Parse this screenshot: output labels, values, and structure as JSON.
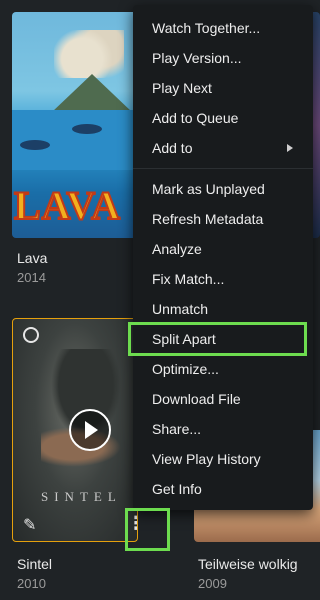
{
  "library": {
    "items": [
      {
        "title": "Lava",
        "year": "2014",
        "poster_text": "LAVA"
      },
      {
        "title": "Sintel",
        "year": "2010",
        "poster_text": "SINTEL"
      },
      {
        "title": "Teilweise wolkig",
        "year": "2009"
      }
    ]
  },
  "context_menu": {
    "items": [
      "Watch Together...",
      "Play Version...",
      "Play Next",
      "Add to Queue",
      "Add to",
      "Mark as Unplayed",
      "Refresh Metadata",
      "Analyze",
      "Fix Match...",
      "Unmatch",
      "Split Apart",
      "Optimize...",
      "Download File",
      "Share...",
      "View Play History",
      "Get Info"
    ]
  },
  "icons": {
    "edit": "✎",
    "more": "⋮"
  },
  "colors": {
    "highlight": "#6ddc4f",
    "selected_border": "#e5a00d",
    "menu_bg": "#181b1d"
  }
}
